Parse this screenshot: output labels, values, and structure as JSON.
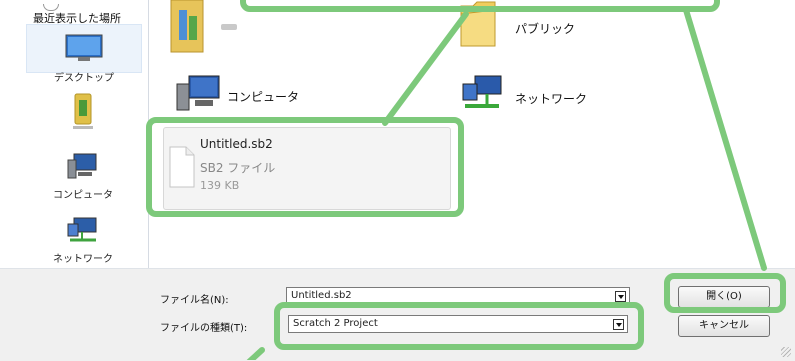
{
  "sidebar": {
    "recent_places": "最近表示した場所",
    "desktop": "デスクトップ",
    "computer": "コンピュータ",
    "network": "ネットワーク"
  },
  "main": {
    "items": {
      "public": "パブリック",
      "computer": "コンピュータ",
      "network": "ネットワーク"
    },
    "file": {
      "name": "Untitled.sb2",
      "type": "SB2 ファイル",
      "size": "139 KB"
    }
  },
  "footer": {
    "filename_label": "ファイル名(N):",
    "filename_value": "Untitled.sb2",
    "filetype_label": "ファイルの種類(T):",
    "filetype_value": "Scratch 2 Project",
    "open_button": "開く(O)",
    "cancel_button": "キャンセル"
  },
  "colors": {
    "highlight": "#7dc97b",
    "sidebar_selected": "#ecf3fb"
  },
  "icons": [
    "recent-places-icon",
    "desktop-icon",
    "library-icon",
    "computer-icon",
    "network-icon",
    "folder-icon",
    "file-icon",
    "dropdown-arrow-icon",
    "resize-grip-icon"
  ]
}
